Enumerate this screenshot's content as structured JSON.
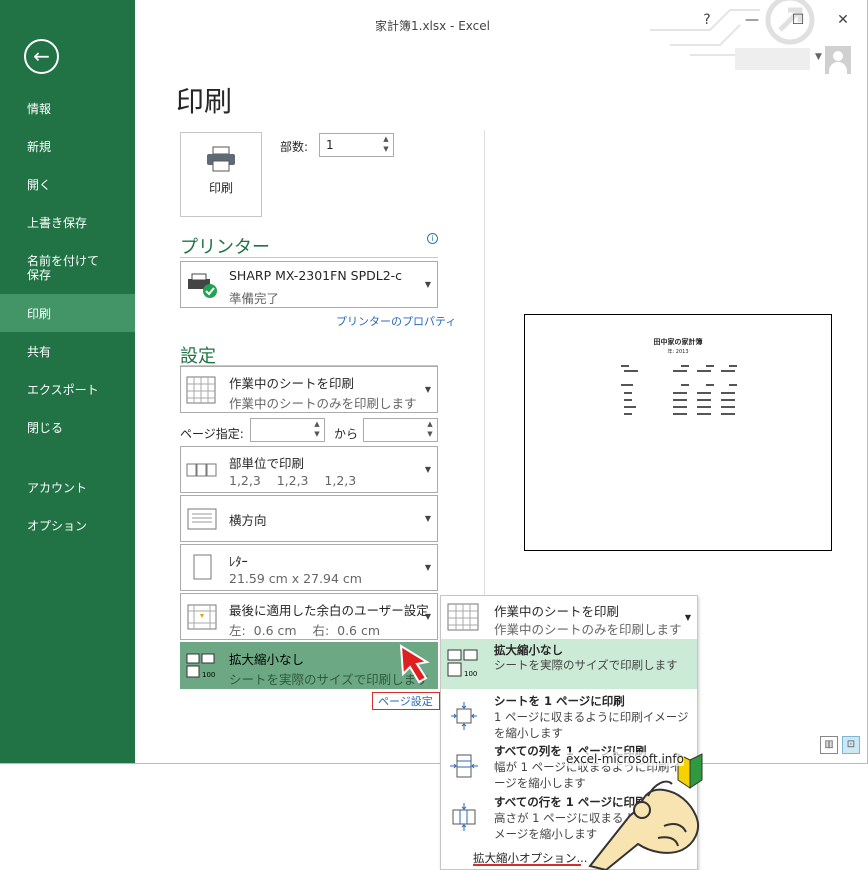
{
  "window": {
    "title": "家計簿1.xlsx - Excel",
    "help": "?",
    "minimize": "—",
    "maximize": "☐",
    "close": "✕"
  },
  "sidebar": {
    "back": "←",
    "items": [
      {
        "label": "情報"
      },
      {
        "label": "新規"
      },
      {
        "label": "開く"
      },
      {
        "label": "上書き保存"
      },
      {
        "label": "名前を付けて\n保存"
      },
      {
        "label": "印刷"
      },
      {
        "label": "共有"
      },
      {
        "label": "エクスポート"
      },
      {
        "label": "閉じる"
      },
      {
        "label": "アカウント"
      },
      {
        "label": "オプション"
      }
    ]
  },
  "page_title": "印刷",
  "print_button": {
    "label": "印刷"
  },
  "copies": {
    "label": "部数:",
    "value": "1"
  },
  "printer": {
    "section_title": "プリンター",
    "name": "SHARP MX-2301FN SPDL2-c",
    "status": "準備完了",
    "properties_link": "プリンターのプロパティ"
  },
  "settings": {
    "section_title": "設定",
    "what": {
      "title": "作業中のシートを印刷",
      "desc": "作業中のシートのみを印刷します"
    },
    "pages_label": "ページ指定:",
    "pages_to": "から",
    "collate": {
      "title": "部単位で印刷",
      "desc": "1,2,3    1,2,3    1,2,3"
    },
    "orientation": {
      "title": "横方向"
    },
    "paper": {
      "title": "ﾚﾀｰ",
      "desc": "21.59 cm x 27.94 cm"
    },
    "margins": {
      "title": "最後に適用した余白のユーザー設定",
      "desc": "左:  0.6 cm    右:  0.6 cm"
    },
    "scaling": {
      "title": "拡大縮小なし",
      "desc": "シートを実際のサイズで印刷します"
    },
    "page_setup_link": "ページ設定"
  },
  "popup": {
    "header": {
      "title": "作業中のシートを印刷",
      "desc": "作業中のシートのみを印刷します"
    },
    "items": [
      {
        "title": "拡大縮小なし",
        "desc": "シートを実際のサイズで印刷します"
      },
      {
        "title": "シートを 1 ページに印刷",
        "desc": "1 ページに収まるように印刷イメージを縮小します"
      },
      {
        "title": "すべての列を 1 ページに印刷",
        "desc": "幅が 1 ページに収まるように印刷イメージを縮小します"
      },
      {
        "title": "すべての行を 1 ページに印刷",
        "desc": "高さが 1 ページに収まるように印刷イメージを縮小します"
      }
    ],
    "footer": "拡大縮小オプション..."
  },
  "preview": {
    "title": "田中家の家計簿",
    "subtitle": "年: 2013"
  },
  "watermark": "excel-microsoft.info",
  "colors": {
    "accent": "#217346",
    "selected": "#439467",
    "link": "#2a6ab8",
    "highlight": "#d32f2f"
  }
}
